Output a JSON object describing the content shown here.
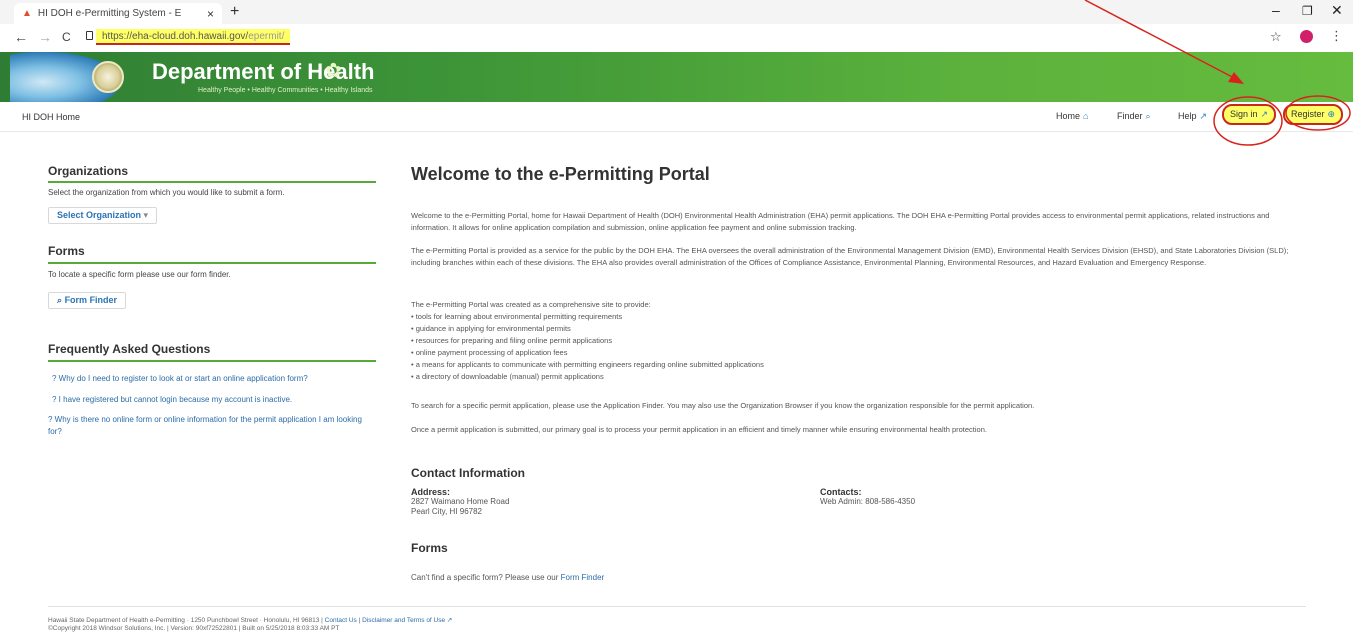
{
  "browser": {
    "tab_title": "HI DOH e-Permitting System - E",
    "tab_close": "×",
    "new_tab": "+",
    "url_main": "https://eha-cloud.doh.hawaii.gov/",
    "url_tail": "epermit/",
    "back": "←",
    "forward": "→",
    "reload": "C",
    "minimize": "–",
    "maximize": "❐",
    "close": "✕",
    "star": "☆",
    "menu": "⋮"
  },
  "banner": {
    "title": "Department of Health",
    "tagline": "Healthy People • Healthy Communities • Healthy Islands"
  },
  "nav": {
    "breadcrumb": "HI DOH Home",
    "home": "Home",
    "finder": "Finder",
    "help": "Help",
    "signin": "Sign in",
    "register": "Register"
  },
  "sidebar": {
    "org_title": "Organizations",
    "org_text": "Select the organization from which you would like to submit a form.",
    "org_button": "Select Organization",
    "forms_title": "Forms",
    "forms_text": "To locate a specific form please use our form finder.",
    "forms_button": "Form Finder",
    "faq_title": "Frequently Asked Questions",
    "faq": [
      "? Why do I need to register to look at or start an online application form?",
      "? I have registered but cannot login because my account is inactive.",
      "? Why is there no online form or online information for the permit application I am looking for?"
    ]
  },
  "main": {
    "title": "Welcome to the e-Permitting Portal",
    "p1": "Welcome to the e-Permitting Portal, home for Hawaii Department of Health (DOH) Environmental Health Administration (EHA) permit applications. The DOH EHA e-Permitting Portal provides access to environmental permit applications, related instructions and information. It allows for online application compilation and submission, online application fee payment and online submission tracking.",
    "p2": "The e-Permitting Portal is provided as a service for the public by the DOH EHA. The EHA oversees the overall administration of the Environmental Management Division (EMD), Environmental Health Services Division (EHSD), and State Laboratories Division (SLD); including branches within each of these divisions. The EHA also provides overall administration of the Offices of Compliance Assistance, Environmental Planning, Environmental Resources, and Hazard Evaluation and Emergency Response.",
    "p3": "The e-Permitting Portal was created as a comprehensive site to provide:",
    "bullets": [
      "• tools for learning about environmental permitting requirements",
      "• guidance in applying for environmental permits",
      "• resources for preparing and filing online permit applications",
      "• online payment processing of application fees",
      "• a means for applicants to communicate with permitting engineers regarding online submitted applications",
      "• a directory of downloadable (manual) permit applications"
    ],
    "p4": "To search for a specific permit application, please use the Application Finder. You may also use the Organization Browser if you know the organization responsible for the permit application.",
    "p5": "Once a permit application is submitted, our primary goal is to process your permit application in an efficient and timely manner while ensuring environmental health protection.",
    "contact_title": "Contact Information",
    "address_label": "Address:",
    "address_line1": "2827 Waimano Home Road",
    "address_line2": "Pearl City, HI 96782",
    "contacts_label": "Contacts:",
    "contacts_value": "Web Admin: 808-586-4350",
    "forms_title": "Forms",
    "forms_text": "Can't find a specific form? Please use our",
    "forms_link": "Form Finder"
  },
  "footer": {
    "line1_a": "Hawaii State Department of Health e-Permitting · 1250 Punchbowl Street · Honolulu, HI 96813 |",
    "contact_us": "Contact Us",
    "sep": "|",
    "disclaimer": "Disclaimer and Terms of Use",
    "line2": "©Copyright 2018 Windsor Solutions, Inc. | Version: 90xf72522801 | Built on 5/25/2018 8:03:33 AM PT"
  },
  "colors": {
    "banner_green": "#4fa73a",
    "link_blue": "#2b6ca8",
    "annotation_red": "#c9261e",
    "highlight_yellow": "#ffff66"
  }
}
